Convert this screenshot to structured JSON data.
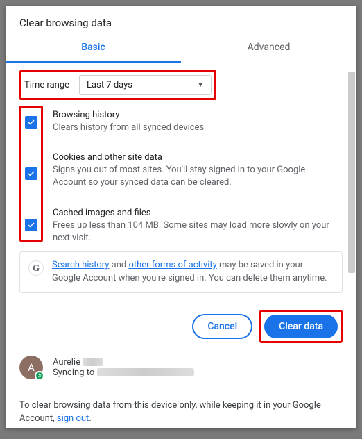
{
  "dialog": {
    "title": "Clear browsing data",
    "tabs": {
      "basic": "Basic",
      "advanced": "Advanced"
    },
    "time_range": {
      "label": "Time range",
      "value": "Last 7 days"
    },
    "options": [
      {
        "title": "Browsing history",
        "desc": "Clears history from all synced devices"
      },
      {
        "title": "Cookies and other site data",
        "desc": "Signs you out of most sites. You'll stay signed in to your Google Account so your synced data can be cleared."
      },
      {
        "title": "Cached images and files",
        "desc": "Frees up less than 104 MB. Some sites may load more slowly on your next visit."
      }
    ],
    "google_box": {
      "link1": "Search history",
      "mid1": " and ",
      "link2": "other forms of activity",
      "mid2": " may be saved in your Google Account when you're signed in. You can delete them anytime."
    },
    "buttons": {
      "cancel": "Cancel",
      "clear": "Clear data"
    },
    "account": {
      "avatar_initial": "A",
      "name": "Aurelie",
      "status_prefix": "Syncing to"
    },
    "footer": {
      "text1": "To clear browsing data from this device only, while keeping it in your Google Account, ",
      "signout": "sign out",
      "text2": "."
    }
  }
}
